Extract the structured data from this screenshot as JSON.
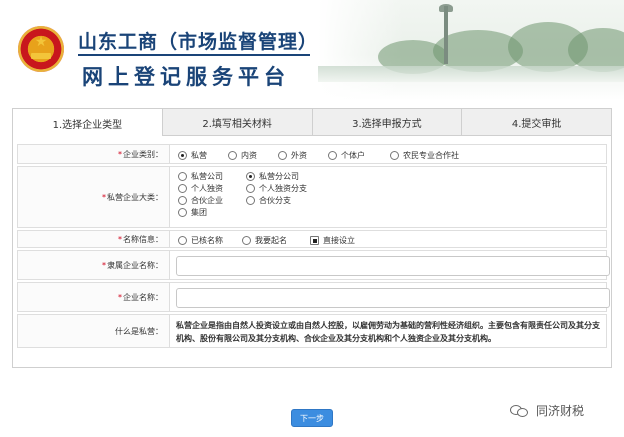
{
  "header": {
    "title_line1": "山东工商（市场监督管理）",
    "title_line2": "网上登记服务平台",
    "emblem": "national-emblem-icon",
    "brand_color": "#1a4478"
  },
  "tabs": [
    {
      "label": "1.选择企业类型",
      "active": true
    },
    {
      "label": "2.填写相关材料",
      "active": false
    },
    {
      "label": "3.选择申报方式",
      "active": false
    },
    {
      "label": "4.提交审批",
      "active": false
    }
  ],
  "form": {
    "enterprise_category": {
      "label": "企业类别：",
      "options": [
        "私营",
        "内资",
        "外资",
        "个体户",
        "农民专业合作社"
      ],
      "selected": "私营"
    },
    "private_enterprise_type": {
      "label": "私营企业大类：",
      "options": [
        "私营公司",
        "私营分公司",
        "个人独资",
        "个人独资分支",
        "合伙企业",
        "合伙分支",
        "集团"
      ],
      "selected": "私营分公司"
    },
    "name_info": {
      "label": "名称信息：",
      "options": [
        "已核名称",
        "我要起名",
        "直接设立"
      ],
      "selected": "直接设立"
    },
    "parent_enterprise_name": {
      "label": "隶属企业名称：",
      "value": "",
      "placeholder": ""
    },
    "enterprise_name": {
      "label": "企业名称：",
      "value": "",
      "placeholder": ""
    },
    "what_is_private": {
      "label": "什么是私营：",
      "text": "私营企业是指由自然人投资设立或由自然人控股，以雇佣劳动为基础的营利性经济组织。主要包含有限责任公司及其分支机构、股份有限公司及其分支机构、合伙企业及其分支机构和个人独资企业及其分支机构。"
    },
    "required_mark": "*"
  },
  "actions": {
    "next_label": "下一步",
    "next_color": "#3c8de0"
  },
  "watermark": {
    "text": "同济财税",
    "icon": "wechat-icon"
  }
}
